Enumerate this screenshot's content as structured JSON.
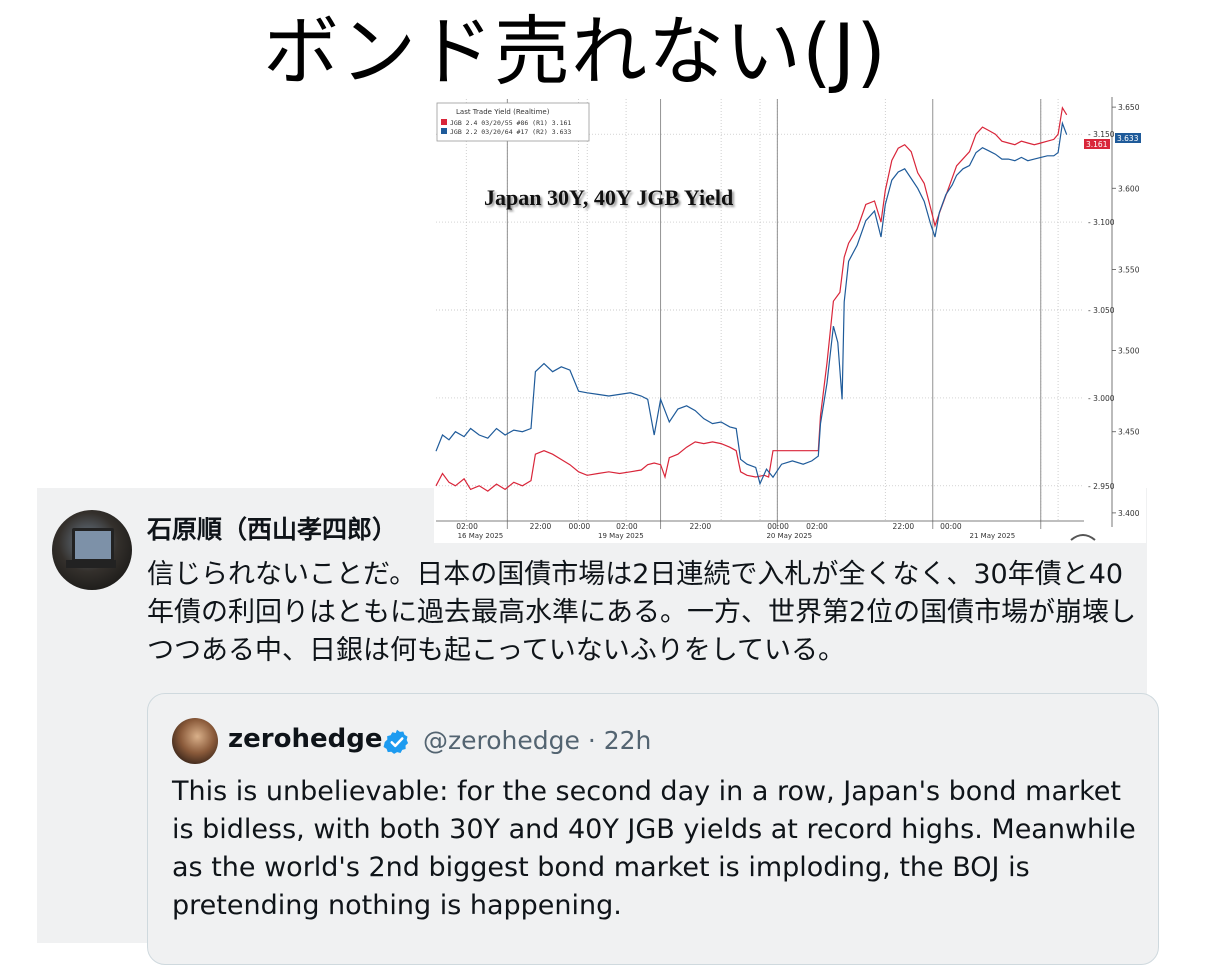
{
  "slide": {
    "title": "ボンド売れない(J)"
  },
  "tweet": {
    "author_name": "石原順（西山孝四郎）",
    "text": "信じられないことだ。日本の国債市場は2日連続で入札が全くなく、30年債と40年債の利回りはともに過去最高水準にある。一方、世界第2位の国債市場が崩壊しつつある中、日銀は何も起こっていないふりをしている。"
  },
  "quoted_tweet": {
    "display_name": "zerohedge",
    "handle_time": "@zerohedge · 22h",
    "text": "This is unbelievable: for the second day in a row, Japan's bond market is bidless, with both 30Y and 40Y JGB yields at record highs. Meanwhile as the world's 2nd biggest bond market is imploding, the BOJ is pretending nothing is happening.",
    "verified_color": "#1d9bf0"
  },
  "chart_data": {
    "type": "line",
    "title": "Japan 30Y, 40Y JGB Yield",
    "legend": {
      "header": "Last Trade Yield (Realtime)",
      "placement": "top-left",
      "items": [
        {
          "label": "JGB 2.4 03/20/55 #86  (R1) 3.161",
          "color": "#d9263a"
        },
        {
          "label": "JGB 2.2 03/20/64 #17  (R2) 3.633",
          "color": "#1f5b9a"
        }
      ]
    },
    "x_tick_labels": [
      "02:00",
      "22:00",
      "00:00",
      "02:00",
      "22:00",
      "00:00",
      "02:00",
      "22:00",
      "00:00"
    ],
    "x_date_labels": [
      "16 May 2025",
      "19 May 2025",
      "20 May 2025",
      "21 May 2025"
    ],
    "y_right_inner": {
      "ticks": [
        "3.150",
        "3.100",
        "3.050",
        "3.000",
        "2.950"
      ],
      "ylim": [
        2.93,
        3.17
      ]
    },
    "y_right_outer": {
      "ticks": [
        "3.650",
        "3.600",
        "3.550",
        "3.500",
        "3.450",
        "3.400"
      ],
      "ylim": [
        3.395,
        3.655
      ]
    },
    "last_value_tags": [
      {
        "text": "3.161",
        "color": "#d9263a"
      },
      {
        "text": "3.633",
        "color": "#1f5b9a"
      }
    ],
    "grid": true,
    "series": [
      {
        "name": "JGB 2.4 03/20/55 #86  (R1)",
        "color": "#d9263a",
        "axis": "inner",
        "values": [
          [
            0,
            2.95
          ],
          [
            3,
            2.957
          ],
          [
            6,
            2.952
          ],
          [
            9,
            2.95
          ],
          [
            13,
            2.954
          ],
          [
            16,
            2.948
          ],
          [
            20,
            2.95
          ],
          [
            24,
            2.947
          ],
          [
            28,
            2.951
          ],
          [
            32,
            2.948
          ],
          [
            36,
            2.952
          ],
          [
            40,
            2.95
          ],
          [
            44,
            2.953
          ],
          [
            46,
            2.968
          ],
          [
            50,
            2.97
          ],
          [
            54,
            2.968
          ],
          [
            58,
            2.965
          ],
          [
            62,
            2.962
          ],
          [
            66,
            2.958
          ],
          [
            70,
            2.956
          ],
          [
            75,
            2.957
          ],
          [
            80,
            2.958
          ],
          [
            85,
            2.957
          ],
          [
            90,
            2.958
          ],
          [
            95,
            2.959
          ],
          [
            98,
            2.962
          ],
          [
            101,
            2.963
          ],
          [
            104,
            2.962
          ],
          [
            106,
            2.955
          ],
          [
            108,
            2.966
          ],
          [
            112,
            2.968
          ],
          [
            116,
            2.972
          ],
          [
            120,
            2.975
          ],
          [
            124,
            2.974
          ],
          [
            128,
            2.975
          ],
          [
            132,
            2.974
          ],
          [
            136,
            2.972
          ],
          [
            139,
            2.97
          ],
          [
            141,
            2.958
          ],
          [
            144,
            2.956
          ],
          [
            148,
            2.955
          ],
          [
            152,
            2.956
          ],
          [
            154,
            2.955
          ],
          [
            156,
            2.97
          ],
          [
            160,
            2.97
          ],
          [
            165,
            2.97
          ],
          [
            170,
            2.97
          ],
          [
            174,
            2.97
          ],
          [
            177,
            2.97
          ],
          [
            178,
            2.99
          ],
          [
            181,
            3.02
          ],
          [
            184,
            3.055
          ],
          [
            187,
            3.06
          ],
          [
            189,
            3.08
          ],
          [
            191,
            3.088
          ],
          [
            195,
            3.096
          ],
          [
            199,
            3.11
          ],
          [
            203,
            3.112
          ],
          [
            206,
            3.1
          ],
          [
            208,
            3.118
          ],
          [
            211,
            3.135
          ],
          [
            214,
            3.142
          ],
          [
            217,
            3.144
          ],
          [
            220,
            3.14
          ],
          [
            223,
            3.128
          ],
          [
            226,
            3.122
          ],
          [
            229,
            3.108
          ],
          [
            231,
            3.098
          ],
          [
            233,
            3.105
          ],
          [
            236,
            3.115
          ],
          [
            239,
            3.125
          ],
          [
            241,
            3.132
          ],
          [
            244,
            3.136
          ],
          [
            247,
            3.14
          ],
          [
            250,
            3.15
          ],
          [
            253,
            3.154
          ],
          [
            256,
            3.152
          ],
          [
            259,
            3.15
          ],
          [
            262,
            3.146
          ],
          [
            265,
            3.145
          ],
          [
            268,
            3.144
          ],
          [
            271,
            3.146
          ],
          [
            274,
            3.145
          ],
          [
            277,
            3.144
          ],
          [
            280,
            3.145
          ],
          [
            283,
            3.146
          ],
          [
            286,
            3.147
          ],
          [
            288,
            3.15
          ],
          [
            290,
            3.165
          ],
          [
            292,
            3.161
          ]
        ]
      },
      {
        "name": "JGB 2.2 03/20/64 #17  (R2)",
        "color": "#1f5b9a",
        "axis": "outer",
        "values": [
          [
            0,
            3.438
          ],
          [
            3,
            3.448
          ],
          [
            6,
            3.445
          ],
          [
            9,
            3.45
          ],
          [
            13,
            3.447
          ],
          [
            16,
            3.452
          ],
          [
            20,
            3.448
          ],
          [
            24,
            3.446
          ],
          [
            28,
            3.452
          ],
          [
            32,
            3.448
          ],
          [
            36,
            3.451
          ],
          [
            40,
            3.45
          ],
          [
            44,
            3.452
          ],
          [
            46,
            3.487
          ],
          [
            50,
            3.492
          ],
          [
            54,
            3.487
          ],
          [
            58,
            3.49
          ],
          [
            62,
            3.488
          ],
          [
            66,
            3.475
          ],
          [
            70,
            3.474
          ],
          [
            75,
            3.473
          ],
          [
            80,
            3.472
          ],
          [
            85,
            3.473
          ],
          [
            90,
            3.474
          ],
          [
            95,
            3.472
          ],
          [
            98,
            3.47
          ],
          [
            101,
            3.448
          ],
          [
            104,
            3.47
          ],
          [
            108,
            3.456
          ],
          [
            112,
            3.464
          ],
          [
            116,
            3.466
          ],
          [
            120,
            3.463
          ],
          [
            124,
            3.458
          ],
          [
            128,
            3.455
          ],
          [
            132,
            3.456
          ],
          [
            136,
            3.453
          ],
          [
            139,
            3.452
          ],
          [
            141,
            3.433
          ],
          [
            144,
            3.43
          ],
          [
            148,
            3.428
          ],
          [
            150,
            3.418
          ],
          [
            153,
            3.427
          ],
          [
            156,
            3.422
          ],
          [
            160,
            3.43
          ],
          [
            165,
            3.432
          ],
          [
            170,
            3.43
          ],
          [
            174,
            3.432
          ],
          [
            177,
            3.435
          ],
          [
            178,
            3.455
          ],
          [
            181,
            3.48
          ],
          [
            184,
            3.515
          ],
          [
            186,
            3.505
          ],
          [
            188,
            3.47
          ],
          [
            189,
            3.53
          ],
          [
            191,
            3.555
          ],
          [
            195,
            3.565
          ],
          [
            199,
            3.58
          ],
          [
            203,
            3.586
          ],
          [
            206,
            3.57
          ],
          [
            208,
            3.59
          ],
          [
            211,
            3.605
          ],
          [
            214,
            3.61
          ],
          [
            217,
            3.612
          ],
          [
            220,
            3.606
          ],
          [
            223,
            3.6
          ],
          [
            226,
            3.592
          ],
          [
            229,
            3.578
          ],
          [
            231,
            3.57
          ],
          [
            233,
            3.585
          ],
          [
            236,
            3.596
          ],
          [
            239,
            3.602
          ],
          [
            241,
            3.608
          ],
          [
            244,
            3.612
          ],
          [
            247,
            3.614
          ],
          [
            250,
            3.622
          ],
          [
            253,
            3.625
          ],
          [
            256,
            3.623
          ],
          [
            259,
            3.621
          ],
          [
            262,
            3.618
          ],
          [
            265,
            3.618
          ],
          [
            268,
            3.617
          ],
          [
            271,
            3.619
          ],
          [
            274,
            3.617
          ],
          [
            277,
            3.618
          ],
          [
            280,
            3.619
          ],
          [
            283,
            3.62
          ],
          [
            286,
            3.62
          ],
          [
            288,
            3.622
          ],
          [
            290,
            3.64
          ],
          [
            292,
            3.633
          ]
        ]
      }
    ]
  }
}
